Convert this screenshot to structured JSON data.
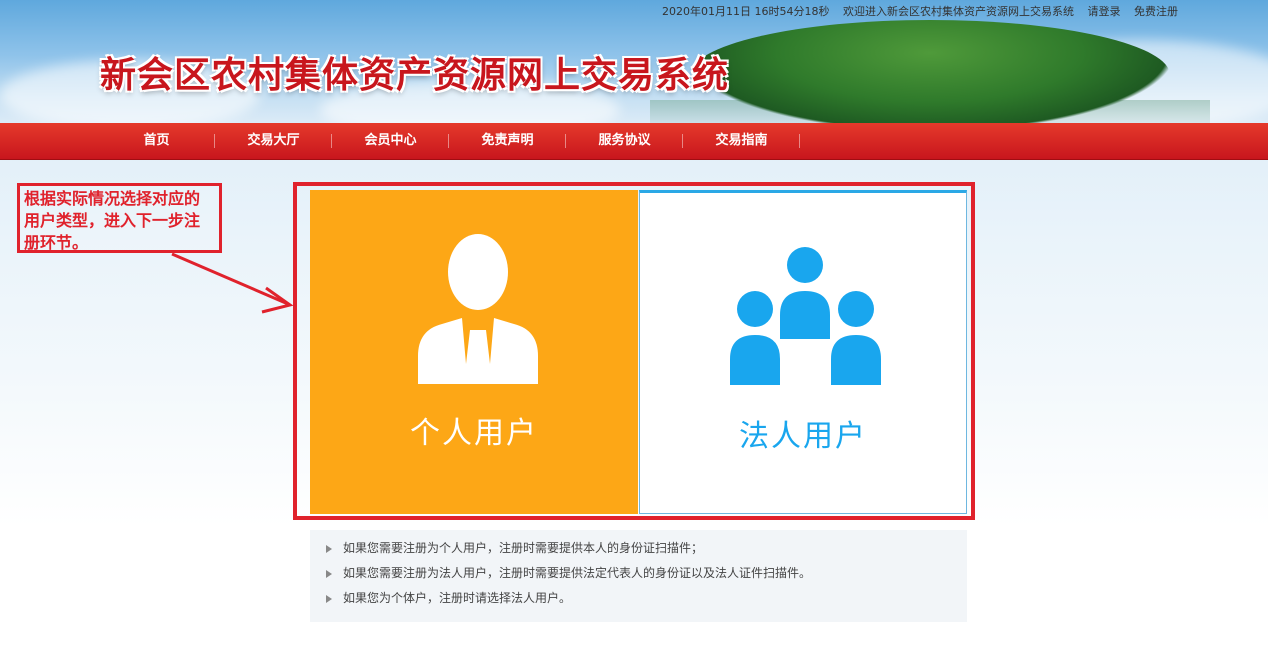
{
  "header": {
    "title": "新会区农村集体资产资源网上交易系统",
    "datetime": "2020年01月11日 16时54分18秒",
    "welcome": "欢迎进入新会区农村集体资产资源网上交易系统",
    "login": "请登录",
    "register": "免费注册"
  },
  "nav": {
    "items": [
      {
        "label": "首页"
      },
      {
        "label": "交易大厅"
      },
      {
        "label": "会员中心"
      },
      {
        "label": "免责声明"
      },
      {
        "label": "服务协议"
      },
      {
        "label": "交易指南"
      }
    ]
  },
  "annotation": {
    "text": "根据实际情况选择对应的用户类型，进入下一步注册环节。"
  },
  "cards": {
    "personal": {
      "label": "个人用户",
      "icon": "person-icon",
      "color": "#fda716"
    },
    "corporate": {
      "label": "法人用户",
      "icon": "group-icon",
      "color": "#19a6ee"
    }
  },
  "notes": {
    "items": [
      "如果您需要注册为个人用户，注册时需要提供本人的身份证扫描件；",
      "如果您需要注册为法人用户，注册时需要提供法定代表人的身份证以及法人证件扫描件。",
      "如果您为个体户，注册时请选择法人用户。"
    ]
  },
  "colors": {
    "accent_red": "#c8161d",
    "annotation_red": "#e0222c"
  }
}
